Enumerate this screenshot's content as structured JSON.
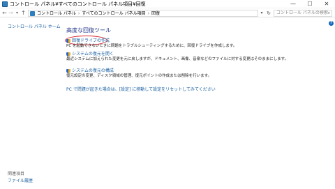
{
  "window": {
    "title": "コントロール パネル¥すべてのコントロール パネル項目¥回復",
    "minimize_glyph": "—",
    "maximize_glyph": "☐",
    "close_glyph": "✕"
  },
  "address_bar": {
    "crumbs": [
      "コントロール パネル",
      "すべてのコントロール パネル項目",
      "回復"
    ],
    "separator": "›",
    "search_placeholder": "コントロール パネルの検索"
  },
  "sidebar": {
    "home_link": "コントロール パネル ホーム",
    "related_title": "関連項目",
    "related_link": "ファイル履歴"
  },
  "main": {
    "title": "高度な回復ツール",
    "tools": [
      {
        "link": "回復ドライブの作成",
        "icon": "shield-icon",
        "desc": "PC を起動できないときに問題をトラブルシューティングするために、回復ドライブを作成します。"
      },
      {
        "link": "システムの復元を開く",
        "icon": "shield-icon",
        "desc": "最近システムに加えられた変更を元に戻しますが、ドキュメント、画像、音楽などのファイルに対する変更はそのままにします。"
      },
      {
        "link": "システムの復元の構成",
        "icon": "shield-icon",
        "desc": "復元設定の変更、ディスク領域の管理、復元ポイントの作成または削除を行います。"
      }
    ],
    "reset_link": "PC で問題が起きた場合は、[設定] に移動して設定をリセットしてみてください"
  },
  "colors": {
    "link": "#1a5fa0",
    "title": "#1e3287",
    "highlight": "#d6282f"
  }
}
